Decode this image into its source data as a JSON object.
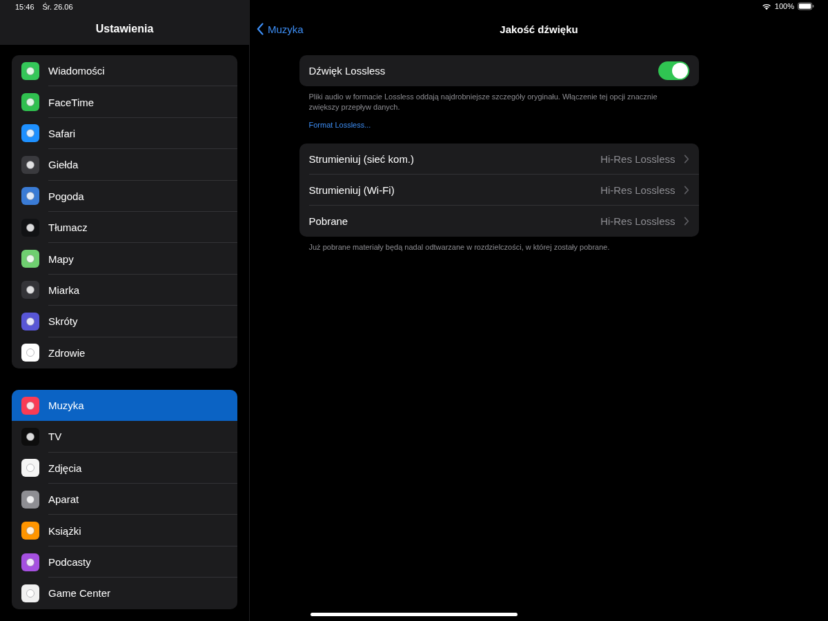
{
  "status_bar": {
    "time": "15:46",
    "date": "Śr. 26.06",
    "battery": "100%"
  },
  "sidebar": {
    "title": "Ustawienia",
    "groups": [
      {
        "items": [
          {
            "label": "Wiadomości",
            "color": "#34c759",
            "selected": false
          },
          {
            "label": "FaceTime",
            "color": "#30c04f",
            "selected": false
          },
          {
            "label": "Safari",
            "color": "#1e90ff",
            "selected": false
          },
          {
            "label": "Giełda",
            "color": "#3a3a3e",
            "selected": false
          },
          {
            "label": "Pogoda",
            "color": "#3a7bd5",
            "selected": false
          },
          {
            "label": "Tłumacz",
            "color": "#111214",
            "selected": false
          },
          {
            "label": "Mapy",
            "color": "#6fcf70",
            "selected": false
          },
          {
            "label": "Miarka",
            "color": "#343438",
            "selected": false
          },
          {
            "label": "Skróty",
            "color": "#5856d6",
            "selected": false
          },
          {
            "label": "Zdrowie",
            "color": "#ffffff",
            "selected": false
          }
        ]
      },
      {
        "items": [
          {
            "label": "Muzyka",
            "color": "#fa3c55",
            "selected": true
          },
          {
            "label": "TV",
            "color": "#0d0d0d",
            "selected": false
          },
          {
            "label": "Zdjęcia",
            "color": "#f5f5f5",
            "selected": false
          },
          {
            "label": "Aparat",
            "color": "#8e8e93",
            "selected": false
          },
          {
            "label": "Książki",
            "color": "#ff9500",
            "selected": false
          },
          {
            "label": "Podcasty",
            "color": "#a550e0",
            "selected": false
          },
          {
            "label": "Game Center",
            "color": "#f0f0f0",
            "selected": false
          }
        ]
      }
    ]
  },
  "nav": {
    "back": "Muzyka",
    "title": "Jakość dźwięku"
  },
  "lossless": {
    "label": "Dźwięk Lossless",
    "on": true,
    "footer": "Pliki audio w formacie Lossless oddają najdrobniejsze szczegóły oryginału. Włączenie tej opcji znacznie zwiększy przepływ danych.",
    "link": "Format Lossless..."
  },
  "quality": {
    "rows": [
      {
        "label": "Strumieniuj (sieć kom.)",
        "value": "Hi-Res Lossless"
      },
      {
        "label": "Strumieniuj (Wi-Fi)",
        "value": "Hi-Res Lossless"
      },
      {
        "label": "Pobrane",
        "value": "Hi-Res Lossless"
      }
    ],
    "footer": "Już pobrane materiały będą nadal odtwarzane w rozdzielczości, w której zostały pobrane."
  }
}
